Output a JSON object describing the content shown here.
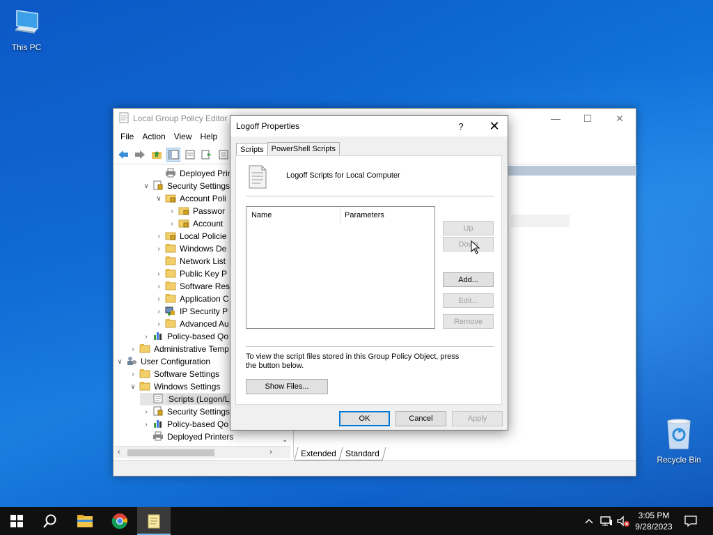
{
  "desktop": {
    "icons": [
      {
        "label": "This PC",
        "icon": "this-pc-icon"
      },
      {
        "label": "Recycle Bin",
        "icon": "recycle-bin-icon"
      }
    ]
  },
  "gpedit": {
    "title": "Local Group Policy Editor",
    "menu": [
      "File",
      "Action",
      "View",
      "Help"
    ],
    "tree": [
      {
        "label": "Deployed Printe",
        "icon": "printer-icon",
        "twisty": ""
      },
      {
        "label": "Security Settings",
        "icon": "security-icon",
        "twisty": "expanded"
      },
      {
        "label": "Account Poli",
        "icon": "folder-lock-icon",
        "twisty": "expanded"
      },
      {
        "label": "Passwor",
        "icon": "folder-lock-icon",
        "twisty": "collapsed"
      },
      {
        "label": "Account",
        "icon": "folder-lock-icon",
        "twisty": "collapsed"
      },
      {
        "label": "Local Policie",
        "icon": "folder-lock-icon",
        "twisty": "collapsed"
      },
      {
        "label": "Windows De",
        "icon": "folder-icon",
        "twisty": "collapsed"
      },
      {
        "label": "Network List",
        "icon": "folder-icon",
        "twisty": ""
      },
      {
        "label": "Public Key P",
        "icon": "folder-icon",
        "twisty": "collapsed"
      },
      {
        "label": "Software Res",
        "icon": "folder-icon",
        "twisty": "collapsed"
      },
      {
        "label": "Application C",
        "icon": "folder-icon",
        "twisty": "collapsed"
      },
      {
        "label": "IP Security P",
        "icon": "ip-security-icon",
        "twisty": "collapsed"
      },
      {
        "label": "Advanced Au",
        "icon": "folder-icon",
        "twisty": "collapsed"
      },
      {
        "label": "Policy-based Qo",
        "icon": "chart-icon",
        "twisty": "collapsed"
      },
      {
        "label": "Administrative Temp",
        "icon": "folder-icon",
        "twisty": "collapsed"
      },
      {
        "label": "User Configuration",
        "icon": "user-config-icon",
        "twisty": "expanded"
      },
      {
        "label": "Software Settings",
        "icon": "folder-icon",
        "twisty": "collapsed"
      },
      {
        "label": "Windows Settings",
        "icon": "folder-icon",
        "twisty": "expanded"
      },
      {
        "label": "Scripts (Logon/L",
        "icon": "script-icon",
        "twisty": "",
        "selected": true
      },
      {
        "label": "Security Settings",
        "icon": "security-icon",
        "twisty": "collapsed"
      },
      {
        "label": "Policy-based Qo",
        "icon": "chart-icon",
        "twisty": "collapsed"
      },
      {
        "label": "Deployed Printers",
        "icon": "printer-icon",
        "twisty": ""
      }
    ],
    "bottom_tabs": [
      "Extended",
      "Standard"
    ]
  },
  "dialog": {
    "title": "Logoff Properties",
    "help": "?",
    "tabs": [
      "Scripts",
      "PowerShell Scripts"
    ],
    "header_text": "Logoff Scripts for Local Computer",
    "list_columns": [
      "Name",
      "Parameters"
    ],
    "buttons": {
      "up": "Up",
      "down": "Down",
      "add": "Add...",
      "edit": "Edit...",
      "remove": "Remove",
      "show_files": "Show Files...",
      "ok": "OK",
      "cancel": "Cancel",
      "apply": "Apply"
    },
    "info_text": "To view the script files stored in this Group Policy Object, press the button below."
  },
  "taskbar": {
    "time": "3:05 PM",
    "date": "9/28/2023"
  }
}
